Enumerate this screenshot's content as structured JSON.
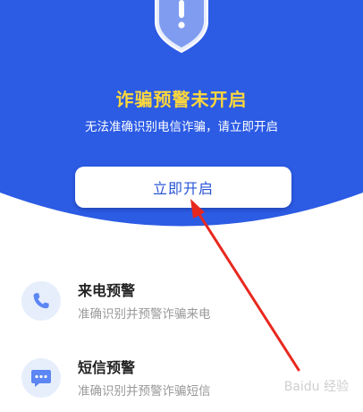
{
  "hero": {
    "title": "诈骗预警未开启",
    "subtitle": "无法准确识别电信诈骗，请立即开启",
    "button_label": "立即开启",
    "background_color": "#2c5be4",
    "title_color": "#ffd83a",
    "shield_icon": "shield-exclamation-icon"
  },
  "features": [
    {
      "title": "来电预警",
      "description": "准确识别并预警诈骗来电",
      "icon": "phone-icon"
    },
    {
      "title": "短信预警",
      "description": "准确识别并预警诈骗短信",
      "icon": "message-icon"
    }
  ],
  "annotation": {
    "arrow_color": "#e8281e"
  },
  "watermark": {
    "text": "Baidu 经验"
  }
}
